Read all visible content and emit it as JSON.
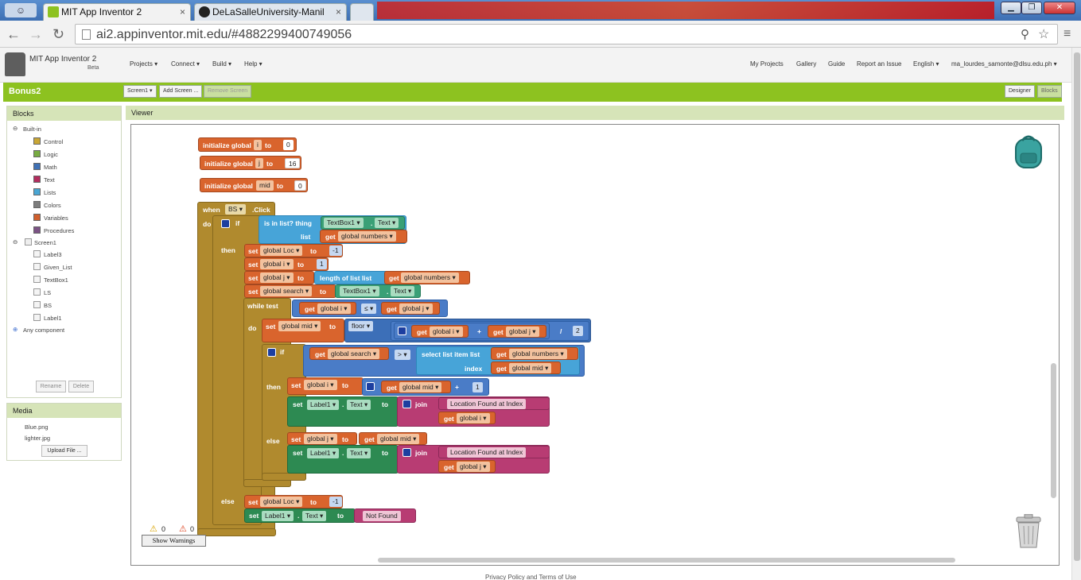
{
  "browser": {
    "tabs": [
      {
        "label": "MIT App Inventor 2",
        "close": "×"
      },
      {
        "label": "DeLaSalleUniversity-Manil",
        "close": "×"
      }
    ],
    "window_buttons": [
      "▁",
      "❐",
      "✕"
    ],
    "url": "ai2.appinventor.mit.edu/#4882299400749056"
  },
  "app": {
    "logo_title": "MIT App Inventor 2",
    "logo_sub": "Beta",
    "menu": [
      "Projects ▾",
      "Connect ▾",
      "Build ▾",
      "Help ▾"
    ],
    "right_menu": [
      "My Projects",
      "Gallery",
      "Guide",
      "Report an Issue",
      "English ▾",
      "ma_lourdes_samonte@dlsu.edu.ph ▾"
    ]
  },
  "toolbar": {
    "project": "Bonus2",
    "screen_select": "Screen1 ▾",
    "add_screen": "Add Screen ...",
    "remove_screen": "Remove Screen",
    "designer": "Designer",
    "blocks": "Blocks"
  },
  "blocks_panel": {
    "title": "Blocks",
    "builtin": "Built-in",
    "builtin_items": [
      {
        "label": "Control",
        "color": "#c9a634"
      },
      {
        "label": "Logic",
        "color": "#77ab41"
      },
      {
        "label": "Math",
        "color": "#3f71b5"
      },
      {
        "label": "Text",
        "color": "#b32d5e"
      },
      {
        "label": "Lists",
        "color": "#49a6d4"
      },
      {
        "label": "Colors",
        "color": "#7d7d7d"
      },
      {
        "label": "Variables",
        "color": "#d05f2d"
      },
      {
        "label": "Procedures",
        "color": "#7c5385"
      }
    ],
    "screen": "Screen1",
    "components": [
      "Label3",
      "Given_List",
      "TextBox1",
      "LS",
      "BS",
      "Label1"
    ],
    "any": "Any component",
    "rename": "Rename",
    "delete": "Delete"
  },
  "media_panel": {
    "title": "Media",
    "files": [
      "Blue.png",
      "lighter.jpg"
    ],
    "upload": "Upload File ..."
  },
  "viewer": {
    "title": "Viewer",
    "warn_count": "0",
    "error_count": "0",
    "show_warnings": "Show Warnings",
    "footer": "Privacy Policy and Terms of Use"
  },
  "blocks": {
    "init_global": "initialize global",
    "to": "to",
    "init": [
      {
        "name": "i",
        "value": "0"
      },
      {
        "name": "j",
        "value": "16"
      },
      {
        "name": "mid",
        "value": "0"
      }
    ],
    "when": "when",
    "component": "BS ▾",
    "event": ".Click",
    "do": "do",
    "if": "if",
    "then": "then",
    "else": "else",
    "is_in_list": "is in list? thing",
    "list": "list",
    "textbox": "TextBox1 ▾",
    "text_prop": "Text ▾",
    "get": "get",
    "set": "set",
    "global_numbers": "global numbers ▾",
    "global_loc": "global Loc ▾",
    "global_i": "global i ▾",
    "global_j": "global j ▾",
    "global_search": "global search ▾",
    "global_mid": "global mid ▾",
    "neg1": "-1",
    "one": "1",
    "two": "2",
    "length_of_list": "length of list  list",
    "while_test": "while  test",
    "lte": "≤ ▾",
    "floor": "floor ▾",
    "plus": "+",
    "div": "/",
    "gt": "> ▾",
    "select_list_item": "select list item  list",
    "index": "index",
    "label1": "Label1 ▾",
    "join": "join",
    "location_found": "Location Found at Index",
    "not_found": "Not Found",
    "dot": "."
  }
}
